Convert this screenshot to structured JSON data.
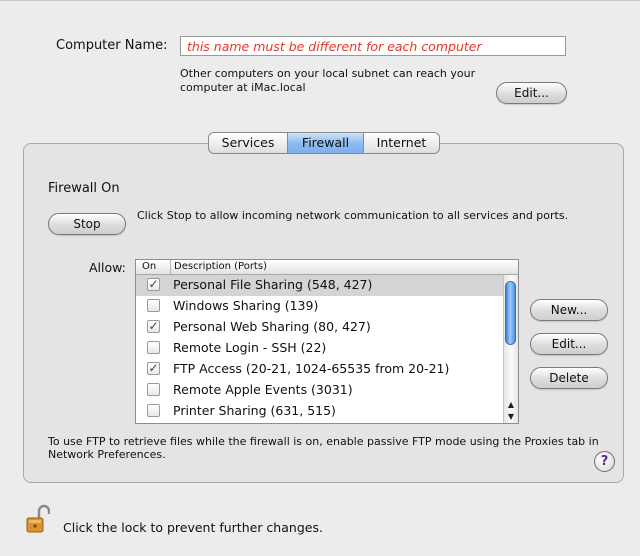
{
  "computer_name": {
    "label": "Computer Name:",
    "value": "this name must be different for each computer",
    "subnet_text": "Other computers on your local subnet can reach your computer at iMac.local",
    "edit_button": "Edit..."
  },
  "tabs": [
    {
      "label": "Services"
    },
    {
      "label": "Firewall",
      "selected": true
    },
    {
      "label": "Internet"
    }
  ],
  "firewall": {
    "status": "Firewall On",
    "stop_button": "Stop",
    "stop_description": "Click Stop to allow incoming network communication to all services and ports.",
    "allow_label": "Allow:",
    "columns": {
      "on": "On",
      "description": "Description (Ports)"
    },
    "services": [
      {
        "checked": true,
        "label": "Personal File Sharing (548, 427)",
        "selected": true
      },
      {
        "checked": false,
        "label": "Windows Sharing (139)"
      },
      {
        "checked": true,
        "label": "Personal Web Sharing (80, 427)"
      },
      {
        "checked": false,
        "label": "Remote Login - SSH (22)"
      },
      {
        "checked": true,
        "label": "FTP Access (20-21, 1024-65535 from 20-21)"
      },
      {
        "checked": false,
        "label": "Remote Apple Events (3031)"
      },
      {
        "checked": false,
        "label": "Printer Sharing (631, 515)"
      }
    ],
    "new_button": "New...",
    "edit_button": "Edit...",
    "delete_button": "Delete",
    "ftp_note": "To use FTP to retrieve files while the firewall is on, enable passive FTP mode using the Proxies tab in Network Preferences.",
    "help_label": "?"
  },
  "lock": {
    "text": "Click the lock to prevent further changes.",
    "icon": "open-padlock-icon"
  }
}
